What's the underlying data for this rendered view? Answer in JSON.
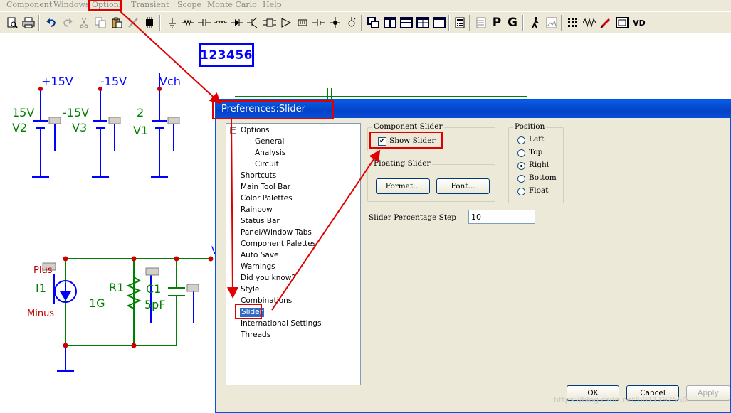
{
  "menu": {
    "items": [
      "Component",
      "Windows",
      "Options",
      "Transient",
      "Scope",
      "Monte Carlo",
      "Help"
    ]
  },
  "toolbar": {
    "icons": [
      "preview-icon",
      "print-icon",
      "undo-icon",
      "redo-icon",
      "cut-icon",
      "copy-icon",
      "paste-icon",
      "delete-icon",
      "chip-icon",
      "ground-icon",
      "resistor-icon",
      "capacitor-icon",
      "inductor-icon",
      "diode-icon",
      "transistor-icon",
      "chip2-icon",
      "opamp-icon",
      "battery-icon",
      "source-icon",
      "node-icon",
      "probe-icon",
      "window1-icon",
      "window2-icon",
      "window3-icon",
      "window4-icon",
      "window5-icon",
      "calculator-icon",
      "text-icon",
      "page-icon",
      "graph-icon",
      "walk-icon",
      "image-icon",
      "grid-icon",
      "wave-icon",
      "pen-icon",
      "frame-icon",
      "vd-icon"
    ],
    "text_buttons": {
      "p": "P",
      "g": "G",
      "vd": "VD"
    }
  },
  "schematic": {
    "label_box": "123456",
    "sources": [
      {
        "node": "+15V",
        "value": "15V",
        "name": "V2"
      },
      {
        "node": "-15V",
        "value": "-15V",
        "name": "V3"
      },
      {
        "node": "Vch",
        "value": "2",
        "name": "V1"
      }
    ],
    "current_source": {
      "name": "I1",
      "plus": "Plus",
      "minus": "Minus"
    },
    "resistor": {
      "name": "R1",
      "value": "1G"
    },
    "capacitor": {
      "name": "C1",
      "value": "5pF"
    },
    "wire_label": "V"
  },
  "dialog": {
    "title": "Preferences:Slider",
    "tree": {
      "root": "Options",
      "root_toggle": "−",
      "children": [
        "General",
        "Analysis",
        "Circuit"
      ],
      "items": [
        "Shortcuts",
        "Main Tool Bar",
        "Color Palettes",
        "Rainbow",
        "Status Bar",
        "Panel/Window Tabs",
        "Component Palettes",
        "Auto Save",
        "Warnings",
        "Did you know?",
        "Style",
        "Combinations",
        "Slider",
        "International Settings",
        "Threads"
      ],
      "selected": "Slider"
    },
    "component_slider": {
      "title": "Component Slider",
      "show_slider_label": "Show Slider",
      "show_slider_checked": true,
      "check_mark": "✔"
    },
    "floating_slider": {
      "title": "Floating Slider",
      "format_label": "Format...",
      "font_label": "Font..."
    },
    "position": {
      "title": "Position",
      "options": [
        "Left",
        "Top",
        "Right",
        "Bottom",
        "Float"
      ],
      "selected": "Right"
    },
    "step": {
      "label": "Slider Percentage Step",
      "value": "10"
    },
    "buttons": {
      "ok": "OK",
      "cancel": "Cancel",
      "apply": "Apply"
    }
  },
  "watermark": "https://blog.csdn.net/u011192550",
  "colors": {
    "annotation": "#e00000",
    "schematic_blue": "#0000ff",
    "schematic_green": "#008000",
    "selected": "#316ac5"
  }
}
